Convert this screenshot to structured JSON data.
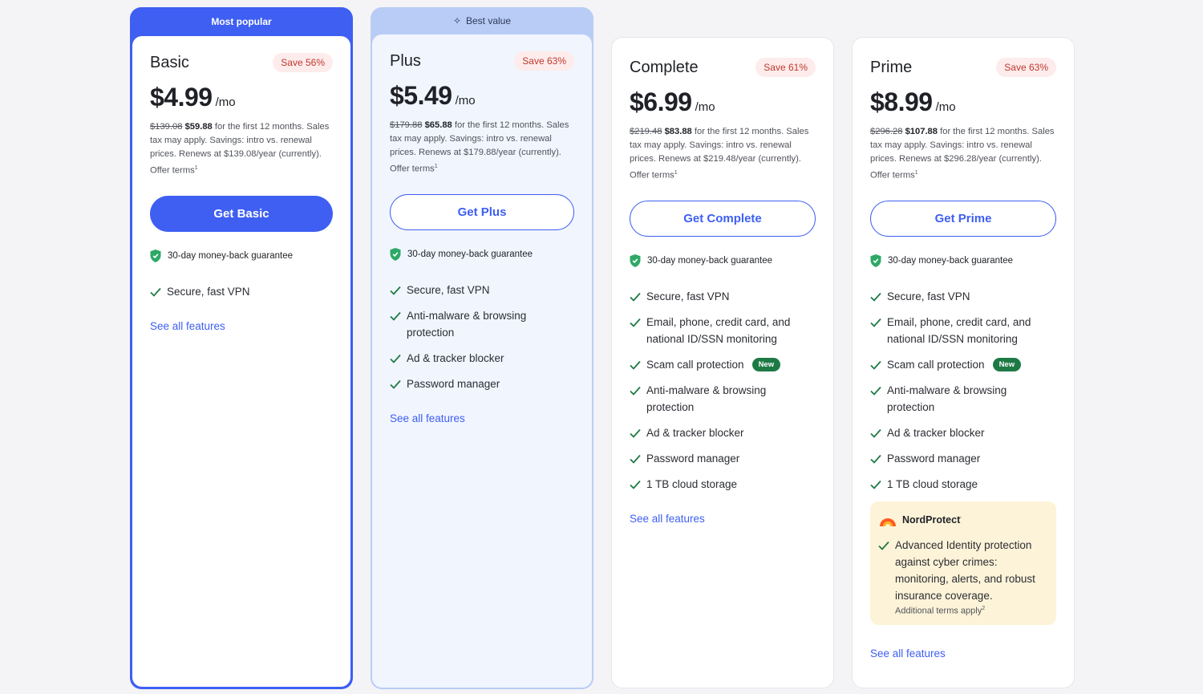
{
  "plans": [
    {
      "ribbon": "Most popular",
      "name": "Basic",
      "save": "Save 56%",
      "price": "$4.99",
      "per": "/mo",
      "old_price": "$139.08",
      "intro_price": "$59.88",
      "fine_1": " for the first 12 months. Sales tax may apply. Savings: intro vs. renewal prices. Renews at $139.08/year (currently). Offer terms",
      "fine_sup": "1",
      "cta": "Get Basic",
      "guarantee": "30-day money-back guarantee",
      "features": [
        "Secure, fast VPN"
      ],
      "see_all": "See all features"
    },
    {
      "ribbon": "Best value",
      "name": "Plus",
      "save": "Save 63%",
      "price": "$5.49",
      "per": "/mo",
      "old_price": "$179.88",
      "intro_price": "$65.88",
      "fine_1": " for the first 12 months. Sales tax may apply. Savings: intro vs. renewal prices. Renews at $179.88/year (currently). Offer terms",
      "fine_sup": "1",
      "cta": "Get Plus",
      "guarantee": "30-day money-back guarantee",
      "features": [
        "Secure, fast VPN",
        "Anti-malware & browsing protection",
        "Ad & tracker blocker",
        "Password manager"
      ],
      "see_all": "See all features"
    },
    {
      "name": "Complete",
      "save": "Save 61%",
      "price": "$6.99",
      "per": "/mo",
      "old_price": "$219.48",
      "intro_price": "$83.88",
      "fine_1": " for the first 12 months. Sales tax may apply. Savings: intro vs. renewal prices. Renews at $219.48/year (currently). Offer terms",
      "fine_sup": "1",
      "cta": "Get Complete",
      "guarantee": "30-day money-back guarantee",
      "features": [
        "Secure, fast VPN",
        "Email, phone, credit card, and national ID/SSN monitoring",
        "Scam call protection",
        "Anti-malware & browsing protection",
        "Ad & tracker blocker",
        "Password manager",
        "1 TB cloud storage"
      ],
      "new_badge": "New",
      "see_all": "See all features"
    },
    {
      "name": "Prime",
      "save": "Save 63%",
      "price": "$8.99",
      "per": "/mo",
      "old_price": "$296.28",
      "intro_price": "$107.88",
      "fine_1": " for the first 12 months. Sales tax may apply. Savings: intro vs. renewal prices. Renews at $296.28/year (currently). Offer terms",
      "fine_sup": "1",
      "cta": "Get Prime",
      "guarantee": "30-day money-back guarantee",
      "features": [
        "Secure, fast VPN",
        "Email, phone, credit card, and national ID/SSN monitoring",
        "Scam call protection",
        "Anti-malware & browsing protection",
        "Ad & tracker blocker",
        "Password manager",
        "1 TB cloud storage"
      ],
      "new_badge": "New",
      "nordprotect": {
        "name": "NordProtect",
        "name_sup": "'",
        "feature": "Advanced Identity protection against cyber crimes: monitoring, alerts, and robust insurance coverage.",
        "terms": "Additional terms apply",
        "terms_sup": "2"
      },
      "see_all": "See all features"
    }
  ],
  "colors": {
    "accent": "#3e5ff2",
    "check": "#1e7a45",
    "shield": "#2ea866",
    "save_bg": "#fdeceb",
    "save_text": "#c0382f",
    "nordprotect_bg": "#fdf3d8"
  },
  "icons": {
    "check": "check-icon",
    "shield": "shield-icon",
    "sparkle": "sparkle-icon",
    "nordprotect": "nordprotect-logo"
  }
}
